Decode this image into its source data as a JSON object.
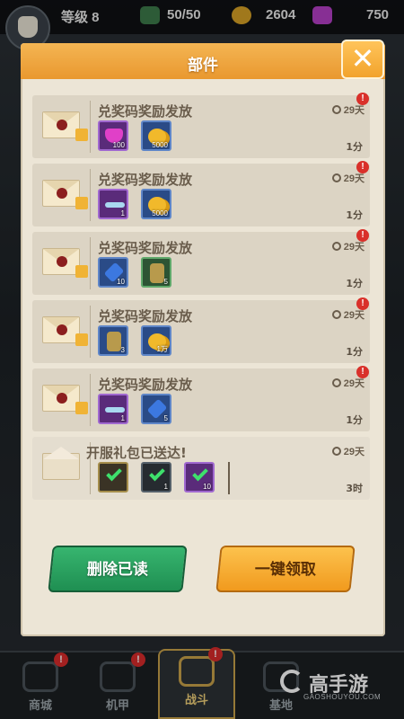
{
  "hud": {
    "level_label": "等级 8",
    "energy": "50/50",
    "coins": "2604",
    "gems": "750"
  },
  "modal": {
    "title": "部件",
    "close_label": "✕"
  },
  "mails": [
    {
      "title": "兑奖码奖励发放",
      "expire": "29天",
      "time": "1分",
      "unread": true,
      "items": [
        {
          "icon": "gem-icon",
          "qty": "100",
          "rarity": "epic"
        },
        {
          "icon": "coin-icon",
          "qty": "5000",
          "rarity": "rare"
        }
      ]
    },
    {
      "title": "兑奖码奖励发放",
      "expire": "29天",
      "time": "1分",
      "unread": true,
      "items": [
        {
          "icon": "key-icon",
          "qty": "1",
          "rarity": "epic"
        },
        {
          "icon": "coin-icon",
          "qty": "5000",
          "rarity": "rare"
        }
      ]
    },
    {
      "title": "兑奖码奖励发放",
      "expire": "29天",
      "time": "1分",
      "unread": true,
      "items": [
        {
          "icon": "crystal-icon",
          "qty": "10",
          "rarity": "rare"
        },
        {
          "icon": "mech-icon",
          "qty": "5",
          "rarity": "green"
        }
      ]
    },
    {
      "title": "兑奖码奖励发放",
      "expire": "29天",
      "time": "1分",
      "unread": true,
      "items": [
        {
          "icon": "mech-icon",
          "qty": "3",
          "rarity": "rare"
        },
        {
          "icon": "coin-icon",
          "qty": "1万",
          "rarity": "rare"
        }
      ]
    },
    {
      "title": "兑奖码奖励发放",
      "expire": "29天",
      "time": "1分",
      "unread": true,
      "items": [
        {
          "icon": "key-icon",
          "qty": "1",
          "rarity": "epic"
        },
        {
          "icon": "crystal-icon",
          "qty": "5",
          "rarity": "rare"
        }
      ]
    },
    {
      "title": "开服礼包已送达!",
      "expire": "29天",
      "time": "3时",
      "unread": false,
      "items": [
        {
          "icon": "check-icon",
          "qty": "",
          "rarity": "legend"
        },
        {
          "icon": "check-icon",
          "qty": "1",
          "rarity": "dark"
        },
        {
          "icon": "check-icon",
          "qty": "10",
          "rarity": "epic"
        }
      ]
    }
  ],
  "unread_badge": "!",
  "buttons": {
    "delete_read": "删除已读",
    "claim_all": "一键领取"
  },
  "nav": {
    "tabs": [
      {
        "label": "商城",
        "badge": "!"
      },
      {
        "label": "机甲",
        "badge": "!"
      },
      {
        "label": "战斗",
        "badge": "!"
      },
      {
        "label": "基地",
        "badge": ""
      }
    ]
  },
  "watermark": {
    "brand": "高手游",
    "domain": "GAOSHOUYOU.COM"
  },
  "colors": {
    "header": "#f0a43a",
    "panel": "#ece5d6",
    "row": "#dcd4c4",
    "green_button": "#2aa462",
    "orange_button": "#f6ad33",
    "badge": "#d9302a"
  }
}
